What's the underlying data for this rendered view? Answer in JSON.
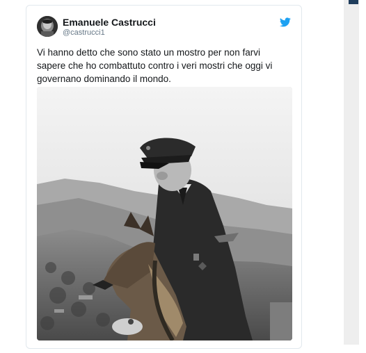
{
  "tweet": {
    "author": {
      "name": "Emanuele Castrucci",
      "handle": "@castrucci1",
      "avatar_icon": "avatar-portrait"
    },
    "platform_icon": "twitter-bird-icon",
    "brand_color": "#1da1f2",
    "text": "Vi hanno detto che sono stato un mostro per non farvi sapere che ho combattuto contro i veri mostri che oggi vi governano dominando il mondo.",
    "photo": {
      "style": "black-and-white photograph",
      "subjects": [
        "man in peaked military cap and uniform",
        "german shepherd dog",
        "mountain valley landscape"
      ]
    }
  }
}
